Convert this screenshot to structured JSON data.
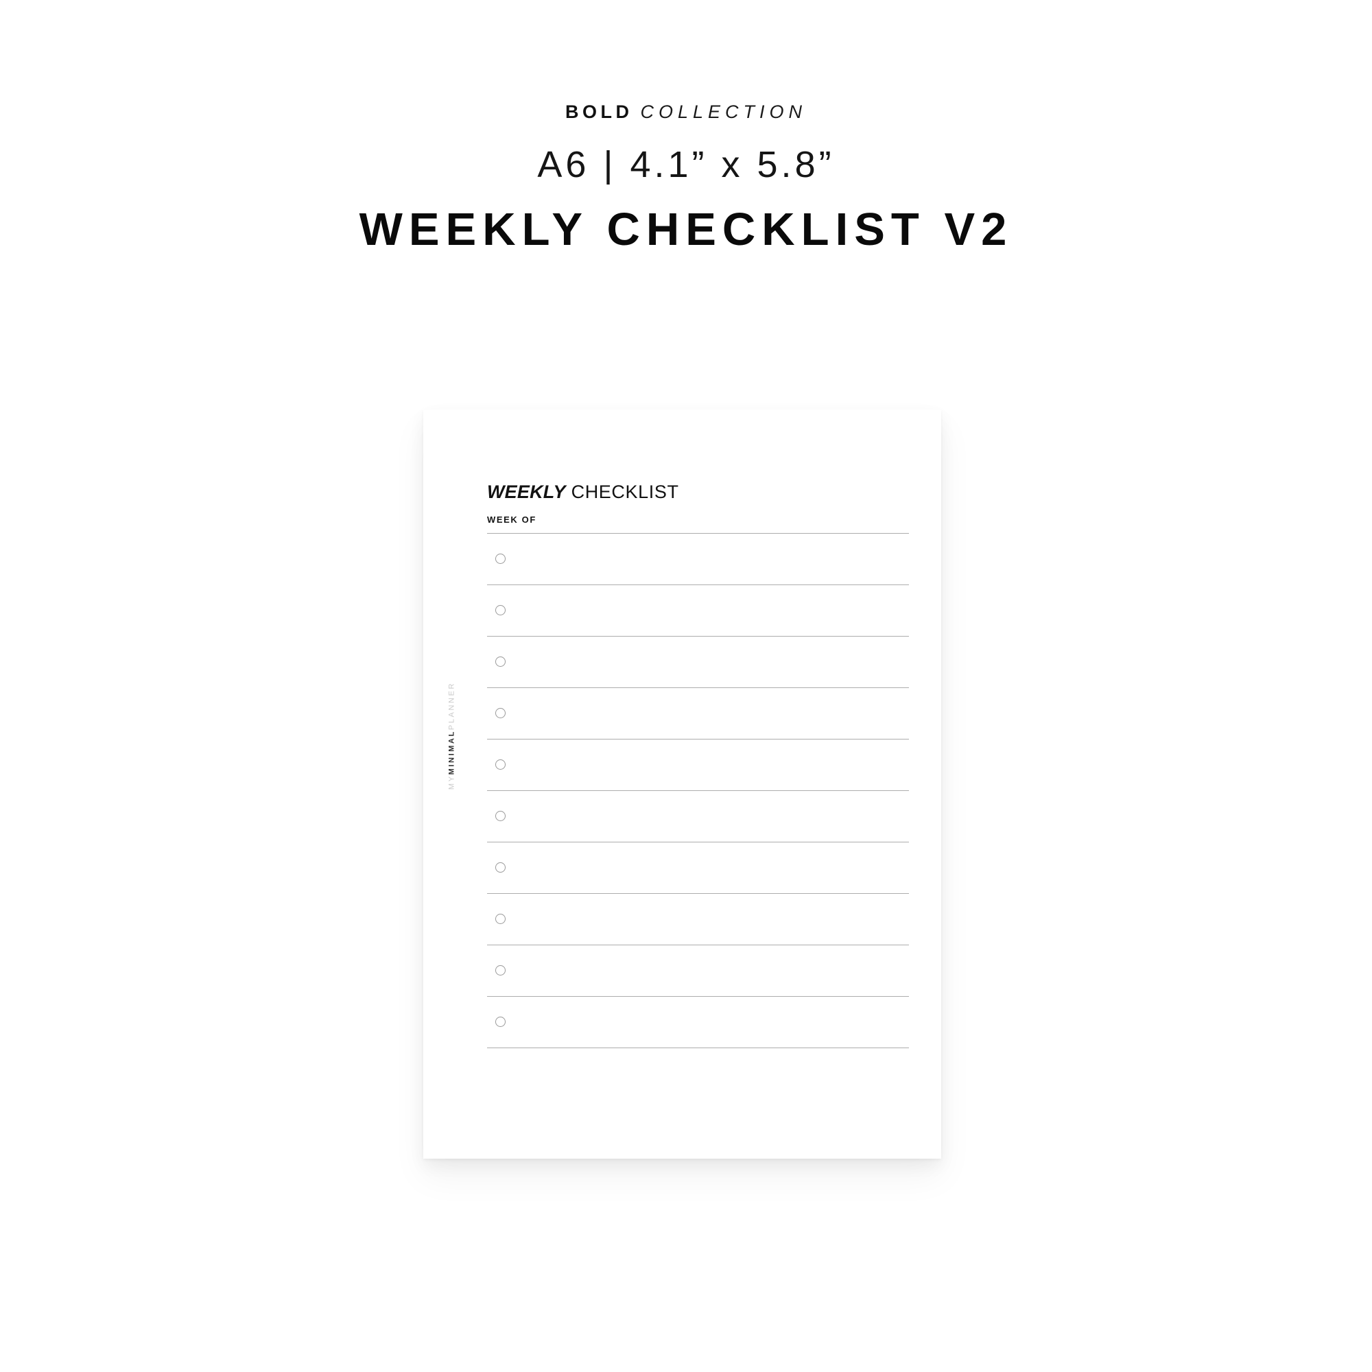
{
  "page": {
    "background_color": "#ffffff",
    "text_color": "#111111"
  },
  "header": {
    "collection_bold": "BOLD",
    "collection_light": "COLLECTION",
    "size_line": "A6 | 4.1” x 5.8”",
    "product_title": "WEEKLY CHECKLIST V2"
  },
  "card": {
    "background_color": "#ffffff",
    "shadow_color": "rgba(0,0,0,0.05)",
    "vertical_brand": {
      "prefix": "MY",
      "emphasis": "MINIMAL",
      "suffix": "PLANNER",
      "light_color": "#c9c9c9",
      "bold_color": "#2f2f2f"
    },
    "sheet": {
      "title_italic": "WEEKLY",
      "title_plain": "CHECKLIST",
      "week_of_label": "WEEK OF",
      "week_of_value": "",
      "rule_color": "#adadad",
      "circle_color": "#9a9a9a",
      "rows": [
        {
          "index": 1,
          "checked": false,
          "text": ""
        },
        {
          "index": 2,
          "checked": false,
          "text": ""
        },
        {
          "index": 3,
          "checked": false,
          "text": ""
        },
        {
          "index": 4,
          "checked": false,
          "text": ""
        },
        {
          "index": 5,
          "checked": false,
          "text": ""
        },
        {
          "index": 6,
          "checked": false,
          "text": ""
        },
        {
          "index": 7,
          "checked": false,
          "text": ""
        },
        {
          "index": 8,
          "checked": false,
          "text": ""
        },
        {
          "index": 9,
          "checked": false,
          "text": ""
        },
        {
          "index": 10,
          "checked": false,
          "text": ""
        }
      ],
      "row_count": 10
    }
  }
}
